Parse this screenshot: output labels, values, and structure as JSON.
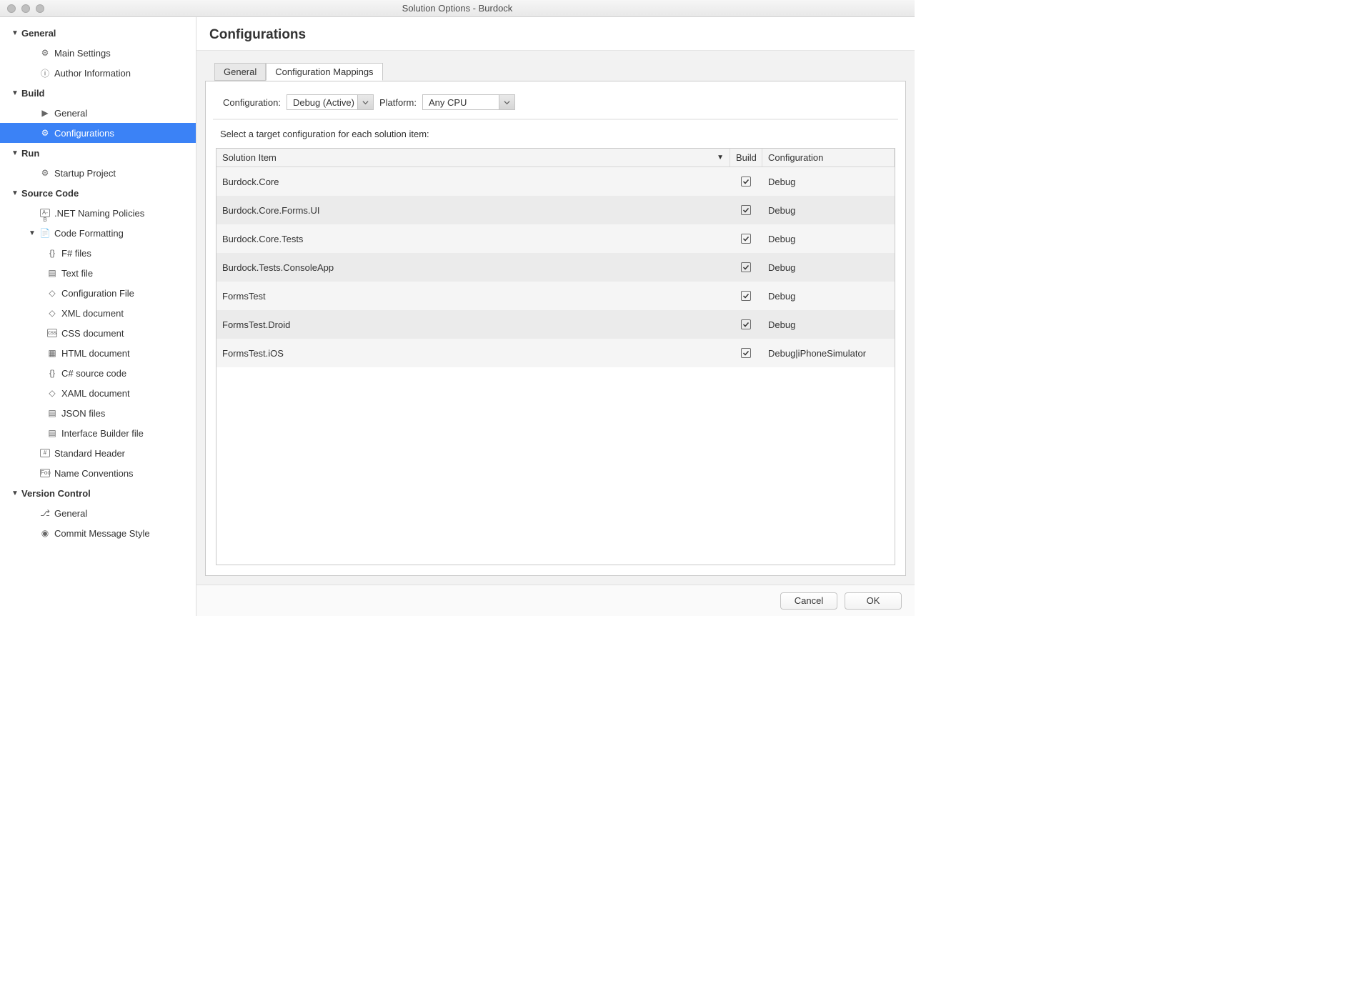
{
  "window": {
    "title": "Solution Options - Burdock"
  },
  "sidebar": {
    "sections": [
      {
        "label": "General",
        "items": [
          {
            "label": "Main Settings",
            "icon": "gear"
          },
          {
            "label": "Author Information",
            "icon": "info"
          }
        ]
      },
      {
        "label": "Build",
        "items": [
          {
            "label": "General",
            "icon": "play"
          },
          {
            "label": "Configurations",
            "icon": "gear",
            "selected": true
          }
        ]
      },
      {
        "label": "Run",
        "items": [
          {
            "label": "Startup Project",
            "icon": "gear"
          }
        ]
      },
      {
        "label": "Source Code",
        "items": [
          {
            "label": ".NET Naming Policies",
            "icon": "ab"
          },
          {
            "label": "Code Formatting",
            "icon": "page",
            "expandable": true,
            "children": [
              {
                "label": "F# files",
                "icon": "braces"
              },
              {
                "label": "Text file",
                "icon": "doc"
              },
              {
                "label": "Configuration File",
                "icon": "xml"
              },
              {
                "label": "XML document",
                "icon": "xml"
              },
              {
                "label": "CSS document",
                "icon": "css"
              },
              {
                "label": "HTML document",
                "icon": "html"
              },
              {
                "label": "C# source code",
                "icon": "braces"
              },
              {
                "label": "XAML document",
                "icon": "xml"
              },
              {
                "label": "JSON files",
                "icon": "doc"
              },
              {
                "label": "Interface Builder file",
                "icon": "doc"
              }
            ]
          },
          {
            "label": "Standard Header",
            "icon": "hash"
          },
          {
            "label": "Name Conventions",
            "icon": "foo"
          }
        ]
      },
      {
        "label": "Version Control",
        "items": [
          {
            "label": "General",
            "icon": "branch"
          },
          {
            "label": "Commit Message Style",
            "icon": "check"
          }
        ]
      }
    ]
  },
  "main": {
    "heading": "Configurations",
    "tabs": {
      "general": "General",
      "mappings": "Configuration Mappings",
      "active": "mappings"
    },
    "config_label": "Configuration:",
    "config_value": "Debug (Active)",
    "platform_label": "Platform:",
    "platform_value": "Any CPU",
    "instruction": "Select a target configuration for each solution item:",
    "columns": {
      "solution": "Solution Item",
      "build": "Build",
      "config": "Configuration"
    },
    "rows": [
      {
        "name": "Burdock.Core",
        "build": true,
        "config": "Debug"
      },
      {
        "name": "Burdock.Core.Forms.UI",
        "build": true,
        "config": "Debug"
      },
      {
        "name": "Burdock.Core.Tests",
        "build": true,
        "config": "Debug"
      },
      {
        "name": "Burdock.Tests.ConsoleApp",
        "build": true,
        "config": "Debug"
      },
      {
        "name": "FormsTest",
        "build": true,
        "config": "Debug"
      },
      {
        "name": "FormsTest.Droid",
        "build": true,
        "config": "Debug"
      },
      {
        "name": "FormsTest.iOS",
        "build": true,
        "config": "Debug|iPhoneSimulator"
      }
    ]
  },
  "footer": {
    "cancel": "Cancel",
    "ok": "OK"
  }
}
